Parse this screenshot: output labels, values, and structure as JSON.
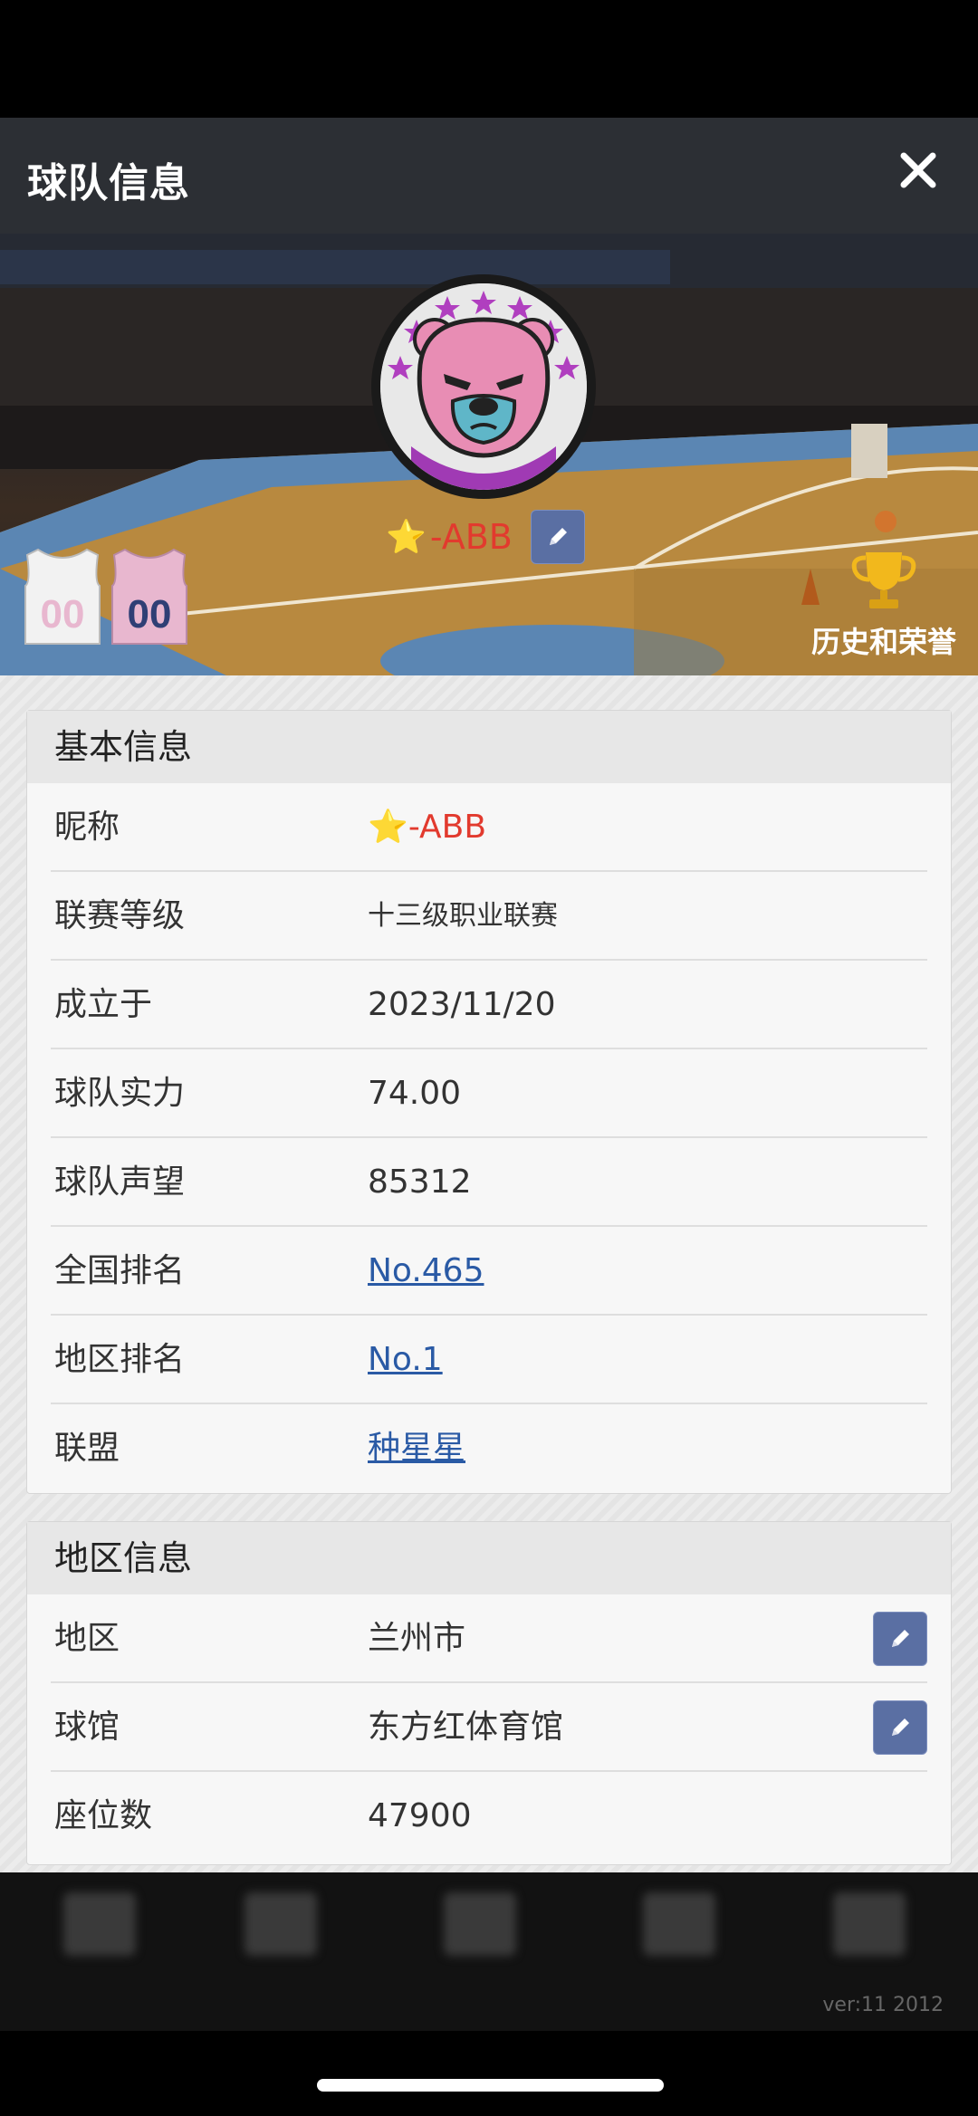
{
  "header": {
    "title": "球队信息",
    "close_icon": "close-icon"
  },
  "banner": {
    "team_name_prefix": "⭐",
    "team_name": "-ABB",
    "jerseys": [
      {
        "number": "00",
        "color": "#ffffff"
      },
      {
        "number": "00",
        "color": "#e8b7cf"
      }
    ],
    "honor_label": "历史和荣誉"
  },
  "basic_info": {
    "title": "基本信息",
    "rows": [
      {
        "key": "昵称",
        "value_prefix": "⭐",
        "value": "-ABB"
      },
      {
        "key": "联赛等级",
        "value": "十三级职业联赛"
      },
      {
        "key": "成立于",
        "value": "2023/11/20"
      },
      {
        "key": "球队实力",
        "value": "74.00"
      },
      {
        "key": "球队声望",
        "value": "85312"
      },
      {
        "key": "全国排名",
        "value": "No.465"
      },
      {
        "key": "地区排名",
        "value": "No.1"
      },
      {
        "key": "联盟",
        "value": "种星星"
      }
    ]
  },
  "region_info": {
    "title": "地区信息",
    "rows": [
      {
        "key": "地区",
        "value": "兰州市"
      },
      {
        "key": "球馆",
        "value": "东方红体育馆"
      },
      {
        "key": "座位数",
        "value": "47900"
      }
    ]
  },
  "footer": {
    "version": "ver:11  2012"
  },
  "colors": {
    "accent_red": "#e23a2e",
    "link_blue": "#2a5aa5",
    "edit_button": "#5a6fa3"
  }
}
